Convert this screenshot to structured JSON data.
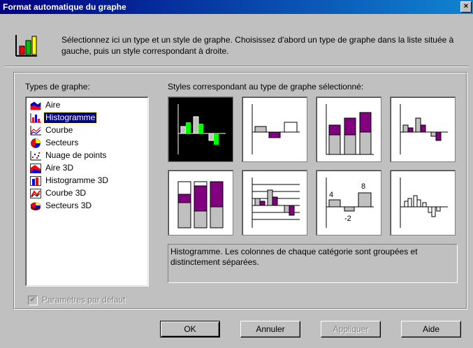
{
  "window": {
    "title": "Format automatique du graphe",
    "close_label": "×"
  },
  "description": "Sélectionnez ici un type et un style de graphe. Choisissez d'abord un type de graphe dans la liste située à gauche, puis un style correspondant à droite.",
  "types_label": "Types de graphe:",
  "types": [
    {
      "label": "Aire",
      "icon": "area-chart-icon"
    },
    {
      "label": "Histogramme",
      "icon": "column-chart-icon",
      "selected": true
    },
    {
      "label": "Courbe",
      "icon": "line-chart-icon"
    },
    {
      "label": "Secteurs",
      "icon": "pie-chart-icon"
    },
    {
      "label": "Nuage de points",
      "icon": "scatter-chart-icon"
    },
    {
      "label": "Aire 3D",
      "icon": "area-3d-chart-icon"
    },
    {
      "label": "Histogramme 3D",
      "icon": "column-3d-chart-icon"
    },
    {
      "label": "Courbe 3D",
      "icon": "line-3d-chart-icon"
    },
    {
      "label": "Secteurs 3D",
      "icon": "pie-3d-chart-icon"
    }
  ],
  "styles_label": "Styles correspondant au type de graphe sélectionné:",
  "style_previews": {
    "style7_labels": [
      "4",
      "8",
      "-2"
    ]
  },
  "style_description": "Histogramme. Les colonnes de chaque catégorie sont groupées et distinctement séparées.",
  "default_settings_label": "Paramètres par défaut",
  "default_settings_checked": true,
  "buttons": {
    "ok": "OK",
    "cancel": "Annuler",
    "apply": "Appliquer",
    "help": "Aide"
  },
  "colors": {
    "titlebar": "#000080",
    "face": "#c0c0c0",
    "accent_purple": "#800080",
    "bar_gray": "#c0c0c0"
  }
}
